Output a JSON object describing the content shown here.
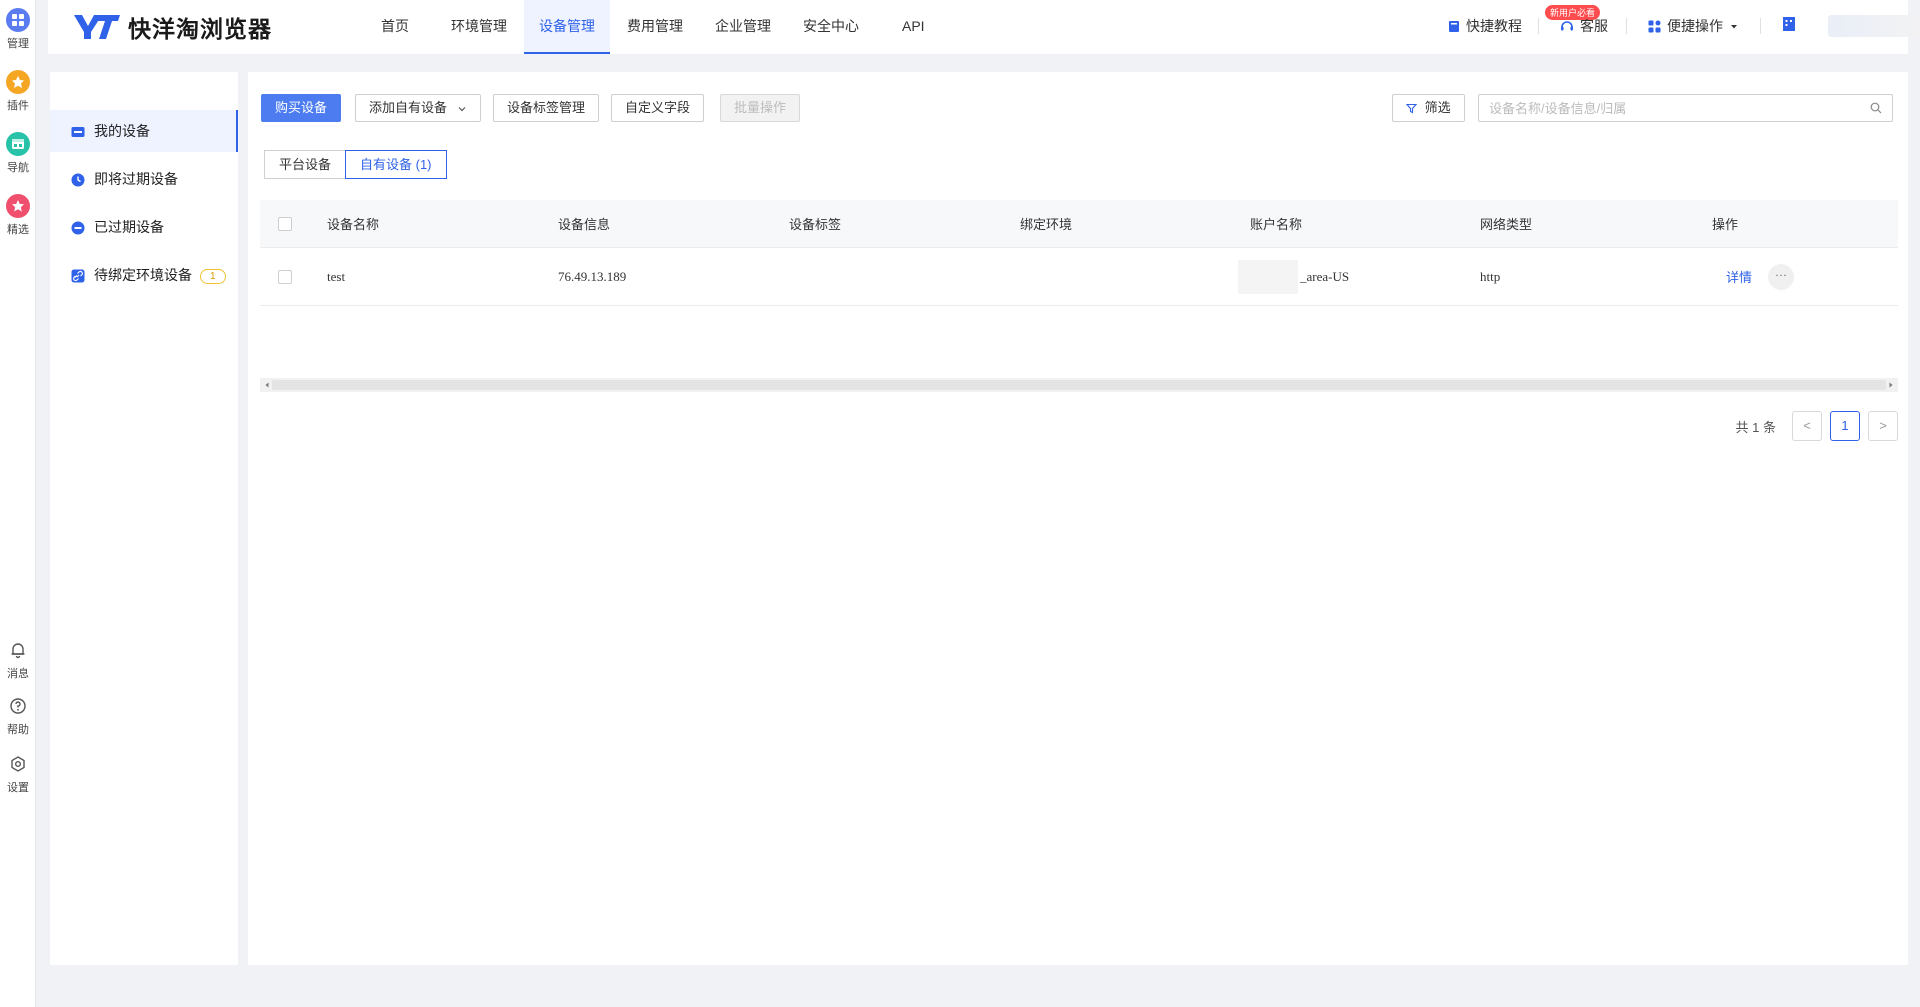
{
  "rail": {
    "top_items": [
      {
        "label": "管理",
        "icon": "grid-icon",
        "color": "#5b7cf0"
      },
      {
        "label": "插件",
        "icon": "puzzle-icon",
        "color": "#f5a623"
      },
      {
        "label": "导航",
        "icon": "browser-icon",
        "color": "#27c2a8"
      },
      {
        "label": "精选",
        "icon": "star-icon",
        "color": "#f0506e"
      }
    ],
    "bottom_items": [
      {
        "label": "消息",
        "icon": "bell-icon"
      },
      {
        "label": "帮助",
        "icon": "help-icon"
      },
      {
        "label": "设置",
        "icon": "gear-icon"
      }
    ]
  },
  "header": {
    "logo_text": "快洋淘浏览器",
    "nav": [
      "首页",
      "环境管理",
      "设备管理",
      "费用管理",
      "企业管理",
      "安全中心",
      "API"
    ],
    "nav_active": "设备管理",
    "tutorial": "快捷教程",
    "tutorial_badge": "新用户必看",
    "support": "客服",
    "quick_ops": "便捷操作"
  },
  "sidebar": {
    "items": [
      {
        "label": "我的设备",
        "icon": "device-icon"
      },
      {
        "label": "即将过期设备",
        "icon": "clock-icon"
      },
      {
        "label": "已过期设备",
        "icon": "minus-circle-icon"
      },
      {
        "label": "待绑定环境设备",
        "icon": "link-icon",
        "count": "1"
      }
    ],
    "active": "我的设备"
  },
  "toolbar": {
    "buy": "购买设备",
    "add_own": "添加自有设备",
    "tag_manage": "设备标签管理",
    "custom_fields": "自定义字段",
    "batch": "批量操作",
    "filter": "筛选",
    "search_placeholder": "设备名称/设备信息/归属"
  },
  "tabs": [
    {
      "label": "平台设备"
    },
    {
      "label": "自有设备 (1)"
    }
  ],
  "tabs_active": "自有设备 (1)",
  "table": {
    "columns": [
      "设备名称",
      "设备信息",
      "设备标签",
      "绑定环境",
      "账户名称",
      "网络类型",
      "操作"
    ],
    "rows": [
      {
        "name": "test",
        "info": "76.49.13.189",
        "tag": "",
        "env": "",
        "account": "_area-US",
        "network": "http",
        "action": "详情",
        "more": "···"
      }
    ]
  },
  "pagination": {
    "total": "共 1 条",
    "current": "1",
    "prev": "<",
    "next": ">"
  },
  "colors": {
    "accent": "#2f62e8",
    "primary_button": "#4c7cf0",
    "badge": "#ff4d4f",
    "background": "#f0f2f5"
  }
}
